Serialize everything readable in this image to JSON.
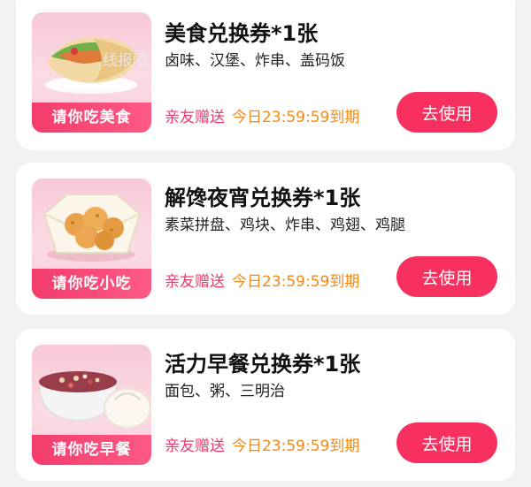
{
  "watermark": "线报酷 new.xianbao.fun",
  "coupons": [
    {
      "title": "美食兑换券*1张",
      "items": "卤味、汉堡、炸串、盖码饭",
      "thumb_label": "请你吃美食",
      "thumb_icon": "wrap-sandwich-icon",
      "gift_text": "亲友赠送",
      "expire_text": "今日23:59:59到期",
      "button_label": "去使用"
    },
    {
      "title": "解馋夜宵兑换券*1张",
      "items": "素菜拼盘、鸡块、炸串、鸡翅、鸡腿",
      "thumb_label": "请你吃小吃",
      "thumb_icon": "chicken-nuggets-icon",
      "gift_text": "亲友赠送",
      "expire_text": "今日23:59:59到期",
      "button_label": "去使用"
    },
    {
      "title": "活力早餐兑换券*1张",
      "items": "面包、粥、三明治",
      "thumb_label": "请你吃早餐",
      "thumb_icon": "porridge-bun-icon",
      "gift_text": "亲友赠送",
      "expire_text": "今日23:59:59到期",
      "button_label": "去使用"
    }
  ],
  "colors": {
    "accent": "#f7305f",
    "gift": "#f0386b",
    "expire": "#f08a1a",
    "background": "#f2f2f4"
  }
}
